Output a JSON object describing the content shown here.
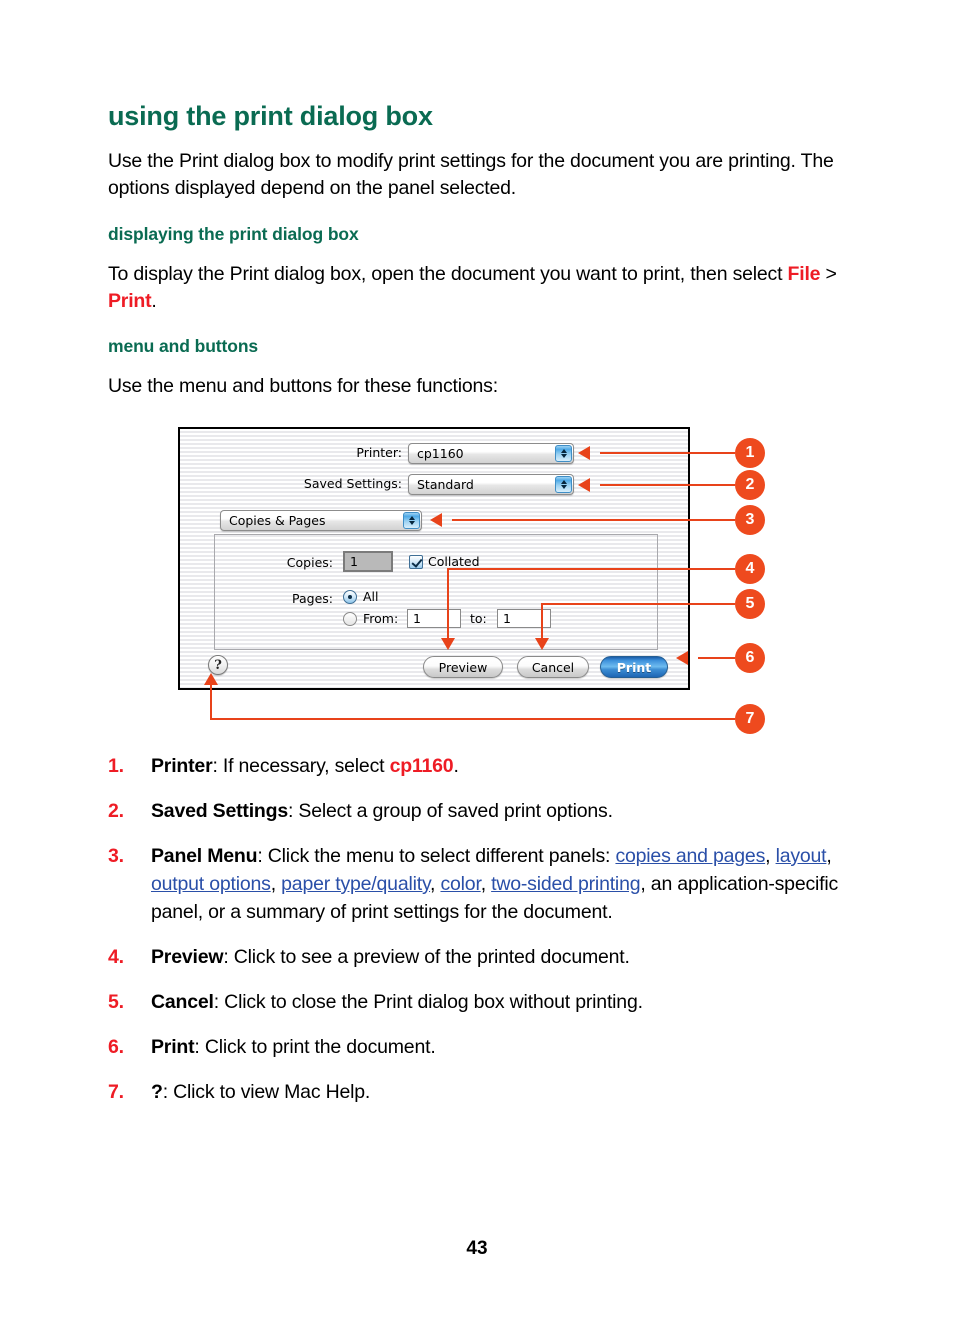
{
  "page": {
    "title": "using the print dialog box",
    "page_number": "43"
  },
  "intro": {
    "paragraph": "Use the Print dialog box to modify print settings for the document you are printing. The options displayed depend on the panel selected."
  },
  "section_displaying": {
    "heading": "displaying the print dialog box",
    "text_before": "To display the Print dialog box, open the document you want to print, then select ",
    "menu_file": "File",
    "separator": " > ",
    "menu_print": "Print",
    "text_after": "."
  },
  "section_menu_buttons": {
    "heading": "menu and buttons",
    "text": "Use the menu and buttons for these functions:"
  },
  "dialog": {
    "printer_label": "Printer:",
    "printer_value": "cp1160",
    "saved_settings_label": "Saved Settings:",
    "saved_settings_value": "Standard",
    "panel_menu_value": "Copies & Pages",
    "copies_label": "Copies:",
    "copies_value": "1",
    "collated_label": "Collated",
    "pages_label": "Pages:",
    "pages_all_label": "All",
    "pages_from_label": "From:",
    "pages_from_value": "1",
    "pages_to_label": "to:",
    "pages_to_value": "1",
    "help_label": "?",
    "preview_label": "Preview",
    "cancel_label": "Cancel",
    "print_label": "Print"
  },
  "callouts": [
    "1",
    "2",
    "3",
    "4",
    "5",
    "6",
    "7"
  ],
  "list": {
    "items": [
      {
        "num": "1.",
        "term": "Printer",
        "text_mid": ": If necessary, select ",
        "emphasis": "cp1160",
        "text_end": "."
      },
      {
        "num": "2.",
        "term": "Saved Settings",
        "text_mid": ": Select a group of saved print options.",
        "emphasis": "",
        "text_end": ""
      },
      {
        "num": "3.",
        "term": "Panel Menu",
        "text_mid": ": Click the menu to select different panels: ",
        "links": [
          "copies and pages",
          "layout",
          "output options",
          "paper type/quality",
          "color",
          "two-sided printing"
        ],
        "text_end": ", an application-specific panel, or a summary of print settings for the document."
      },
      {
        "num": "4.",
        "term": "Preview",
        "text_mid": ": Click to see a preview of the printed document.",
        "emphasis": "",
        "text_end": ""
      },
      {
        "num": "5.",
        "term": "Cancel",
        "text_mid": ": Click to close the Print dialog box without printing.",
        "emphasis": "",
        "text_end": ""
      },
      {
        "num": "6.",
        "term": "Print",
        "text_mid": ": Click to print the document.",
        "emphasis": "",
        "text_end": ""
      },
      {
        "num": "7.",
        "term": "?",
        "text_mid": ": Click to view Mac Help.",
        "emphasis": "",
        "text_end": ""
      }
    ]
  },
  "colors": {
    "heading_green": "#0a6b52",
    "accent_red": "#ee1c25",
    "callout_orange": "#ee4a1e",
    "link_blue": "#2a4fa8"
  }
}
